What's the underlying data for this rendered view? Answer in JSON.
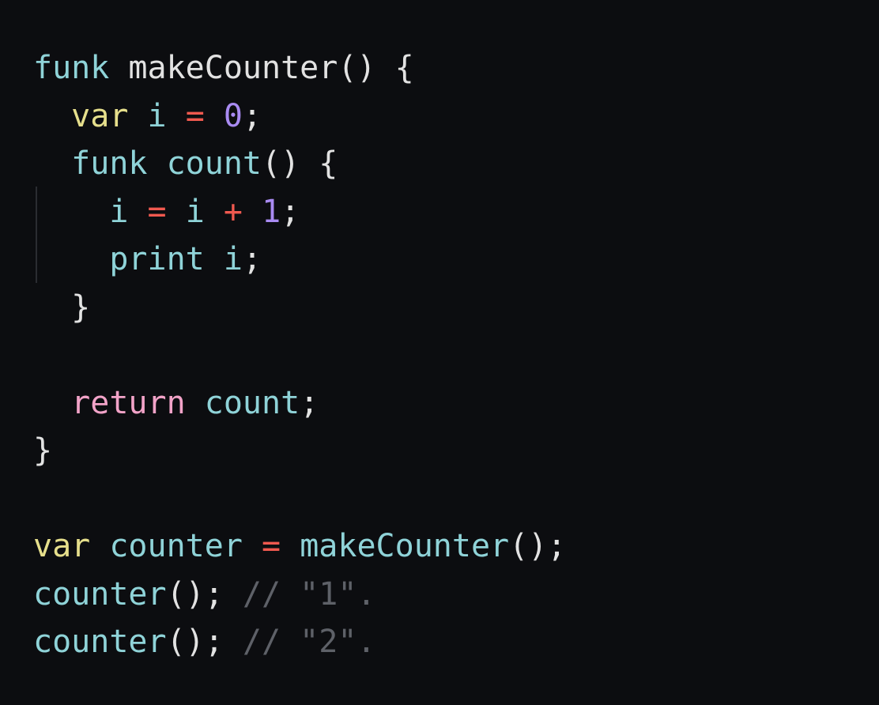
{
  "colors": {
    "background": "#0c0d10",
    "keyword_func": "#8fd3d8",
    "keyword_var": "#e6df8c",
    "keyword_return": "#f2a3c8",
    "identifier": "#8fd3d8",
    "operator": "#f0594f",
    "number": "#a98bf2",
    "comment": "#5e6168",
    "punctuation": "#e2e2e2"
  },
  "code": {
    "lines": [
      [
        {
          "t": "funk",
          "c": "kw-func"
        },
        {
          "t": " ",
          "c": "plain"
        },
        {
          "t": "makeCounter",
          "c": "plain"
        },
        {
          "t": "() {",
          "c": "plain"
        }
      ],
      [
        {
          "t": "  ",
          "c": "plain"
        },
        {
          "t": "var",
          "c": "kw-var"
        },
        {
          "t": " ",
          "c": "plain"
        },
        {
          "t": "i",
          "c": "ident"
        },
        {
          "t": " ",
          "c": "plain"
        },
        {
          "t": "=",
          "c": "op"
        },
        {
          "t": " ",
          "c": "plain"
        },
        {
          "t": "0",
          "c": "num"
        },
        {
          "t": ";",
          "c": "plain"
        }
      ],
      [
        {
          "t": "  ",
          "c": "plain"
        },
        {
          "t": "funk",
          "c": "kw-func"
        },
        {
          "t": " ",
          "c": "plain"
        },
        {
          "t": "count",
          "c": "ident"
        },
        {
          "t": "() {",
          "c": "plain"
        }
      ],
      [
        {
          "t": "    ",
          "c": "plain"
        },
        {
          "t": "i",
          "c": "ident"
        },
        {
          "t": " ",
          "c": "plain"
        },
        {
          "t": "=",
          "c": "op"
        },
        {
          "t": " ",
          "c": "plain"
        },
        {
          "t": "i",
          "c": "ident"
        },
        {
          "t": " ",
          "c": "plain"
        },
        {
          "t": "+",
          "c": "op"
        },
        {
          "t": " ",
          "c": "plain"
        },
        {
          "t": "1",
          "c": "num"
        },
        {
          "t": ";",
          "c": "plain"
        }
      ],
      [
        {
          "t": "    ",
          "c": "plain"
        },
        {
          "t": "print",
          "c": "ident"
        },
        {
          "t": " ",
          "c": "plain"
        },
        {
          "t": "i",
          "c": "ident"
        },
        {
          "t": ";",
          "c": "plain"
        }
      ],
      [
        {
          "t": "  ",
          "c": "plain"
        },
        {
          "t": "}",
          "c": "plain"
        }
      ],
      [],
      [
        {
          "t": "  ",
          "c": "plain"
        },
        {
          "t": "return",
          "c": "kw-ret"
        },
        {
          "t": " ",
          "c": "plain"
        },
        {
          "t": "count",
          "c": "ident"
        },
        {
          "t": ";",
          "c": "plain"
        }
      ],
      [
        {
          "t": "}",
          "c": "plain"
        }
      ],
      [],
      [
        {
          "t": "var",
          "c": "kw-var"
        },
        {
          "t": " ",
          "c": "plain"
        },
        {
          "t": "counter",
          "c": "ident"
        },
        {
          "t": " ",
          "c": "plain"
        },
        {
          "t": "=",
          "c": "op"
        },
        {
          "t": " ",
          "c": "plain"
        },
        {
          "t": "makeCounter",
          "c": "ident"
        },
        {
          "t": "();",
          "c": "plain"
        }
      ],
      [
        {
          "t": "counter",
          "c": "ident"
        },
        {
          "t": "();",
          "c": "plain"
        },
        {
          "t": " ",
          "c": "plain"
        },
        {
          "t": "// \"1\".",
          "c": "comment"
        }
      ],
      [
        {
          "t": "counter",
          "c": "ident"
        },
        {
          "t": "();",
          "c": "plain"
        },
        {
          "t": " ",
          "c": "plain"
        },
        {
          "t": "// \"2\".",
          "c": "comment"
        }
      ]
    ]
  }
}
